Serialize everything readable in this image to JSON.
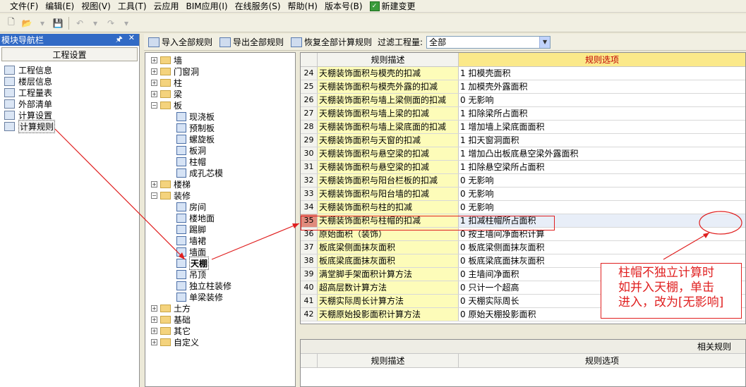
{
  "menu": [
    {
      "name": "file",
      "label": "文件(F)"
    },
    {
      "name": "edit",
      "label": "编辑(E)"
    },
    {
      "name": "view",
      "label": "视图(V)"
    },
    {
      "name": "tools",
      "label": "工具(T)"
    },
    {
      "name": "cloud",
      "label": "云应用"
    },
    {
      "name": "bim",
      "label": "BIM应用(I)"
    },
    {
      "name": "online",
      "label": "在线服务(S)"
    },
    {
      "name": "help",
      "label": "帮助(H)"
    },
    {
      "name": "version",
      "label": "版本号(B)"
    }
  ],
  "menu_new_change": "新建变更",
  "nav": {
    "title": "模块导航栏",
    "section": "工程设置",
    "items": [
      "工程信息",
      "楼层信息",
      "工程量表",
      "外部清单",
      "计算设置",
      "计算规则"
    ]
  },
  "rules_toolbar": {
    "import_all": "导入全部规则",
    "export_all": "导出全部规则",
    "restore_all": "恢复全部计算规则",
    "filter_label": "过滤工程量:",
    "filter_value": "全部"
  },
  "tree": {
    "wall": "墙",
    "door_window": "门窗洞",
    "column": "柱",
    "beam": "梁",
    "slab": "板",
    "slab_children": [
      "现浇板",
      "预制板",
      "螺旋板",
      "板洞",
      "柱帽",
      "成孔芯模"
    ],
    "stairs": "楼梯",
    "decoration": "装修",
    "decoration_children": [
      "房间",
      "楼地面",
      "踢脚",
      "墙裙",
      "墙面",
      "天棚",
      "吊顶",
      "独立柱装修",
      "单梁装修"
    ],
    "earthwork": "土方",
    "foundation": "基础",
    "others": "其它",
    "custom": "自定义"
  },
  "grid": {
    "col_desc": "规则描述",
    "col_opt": "规则选项",
    "rows": [
      {
        "num": "24",
        "desc": "天棚装饰面积与模壳的扣减",
        "opt": "1 扣模壳面积"
      },
      {
        "num": "25",
        "desc": "天棚装饰面积与模壳外露的扣减",
        "opt": "1 加模壳外露面积"
      },
      {
        "num": "26",
        "desc": "天棚装饰面积与墙上梁侧面的扣减",
        "opt": "0  无影响"
      },
      {
        "num": "27",
        "desc": "天棚装饰面积与墙上梁的扣减",
        "opt": "1 扣除梁所占面积"
      },
      {
        "num": "28",
        "desc": "天棚装饰面积与墙上梁底面的扣减",
        "opt": "1 增加墙上梁底面面积"
      },
      {
        "num": "29",
        "desc": "天棚装饰面积与天窗的扣减",
        "opt": "1 扣天窗洞面积"
      },
      {
        "num": "30",
        "desc": "天棚装饰面积与悬空梁的扣减",
        "opt": "1 增加凸出板底悬空梁外露面积"
      },
      {
        "num": "31",
        "desc": "天棚装饰面积与悬空梁的扣减",
        "opt": "1 扣除悬空梁所占面积"
      },
      {
        "num": "32",
        "desc": "天棚装饰面积与阳台栏板的扣减",
        "opt": "0  无影响"
      },
      {
        "num": "33",
        "desc": "天棚装饰面积与阳台墙的扣减",
        "opt": "0  无影响"
      },
      {
        "num": "34",
        "desc": "天棚装饰面积与柱的扣减",
        "opt": "0  无影响"
      },
      {
        "num": "35",
        "desc": "天棚装饰面积与柱帽的扣减",
        "opt": "1 扣减柱帽所占面积"
      },
      {
        "num": "36",
        "desc": "原始面积（装饰）",
        "opt": "0 按主墙间净面积计算"
      },
      {
        "num": "37",
        "desc": "板底梁侧面抹灰面积",
        "opt": "0 板底梁侧面抹灰面积"
      },
      {
        "num": "38",
        "desc": "板底梁底面抹灰面积",
        "opt": "0 板底梁底面抹灰面积"
      },
      {
        "num": "39",
        "desc": "满堂脚手架面积计算方法",
        "opt": "0 主墙间净面积"
      },
      {
        "num": "40",
        "desc": "超高层数计算方法",
        "opt": "0 只计一个超高"
      },
      {
        "num": "41",
        "desc": "天棚实际周长计算方法",
        "opt": "0 天棚实际周长"
      },
      {
        "num": "42",
        "desc": "天棚原始投影面积计算方法",
        "opt": "0 原始天棚投影面积"
      }
    ]
  },
  "related": {
    "title": "相关规则",
    "col_desc": "规则描述",
    "col_opt": "规则选项"
  },
  "annotation": {
    "lines": [
      "柱帽不独立计算时",
      "如并入天棚，单击",
      "进入，改为[无影响]"
    ]
  },
  "colors": {
    "accent": "#e02020",
    "nav_title": "#316ac5",
    "desc_cell": "#fdfcb9",
    "opt_header": "#fbe98a"
  }
}
